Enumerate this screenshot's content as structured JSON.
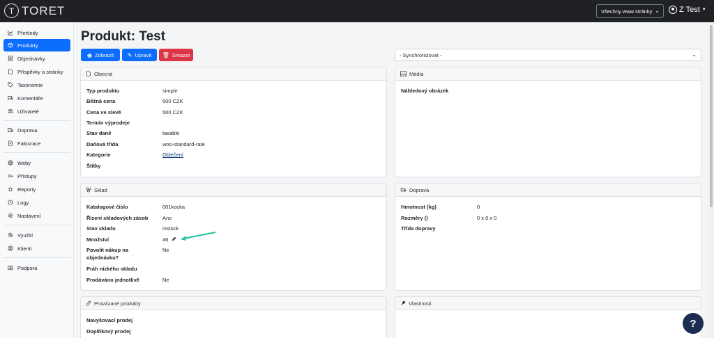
{
  "header": {
    "logo_letter": "T",
    "logo_text": "TORET",
    "site_select": "Všechny www stránky",
    "user_name": "Z Test"
  },
  "sidebar": {
    "items": [
      {
        "label": "Přehledy",
        "icon": "chart-icon"
      },
      {
        "label": "Produkty",
        "icon": "box-icon",
        "active": true
      },
      {
        "label": "Objednávky",
        "icon": "list-icon"
      },
      {
        "label": "Příspěvky a stránky",
        "icon": "file-icon"
      },
      {
        "label": "Taxonomie",
        "icon": "tags-icon"
      },
      {
        "label": "Komentáře",
        "icon": "comments-icon"
      },
      {
        "label": "Uživatelé",
        "icon": "users-icon"
      },
      {
        "label": "Doprava",
        "icon": "truck-icon"
      },
      {
        "label": "Fakturace",
        "icon": "invoice-icon"
      },
      {
        "label": "Weby",
        "icon": "globe-icon"
      },
      {
        "label": "Přístupy",
        "icon": "key-icon"
      },
      {
        "label": "Reporty",
        "icon": "bug-icon"
      },
      {
        "label": "Logy",
        "icon": "log-icon"
      },
      {
        "label": "Nastavení",
        "icon": "gear-icon"
      },
      {
        "label": "Využití",
        "icon": "gear-cog-icon"
      },
      {
        "label": "Klienti",
        "icon": "person-circle-icon"
      },
      {
        "label": "Podpora",
        "icon": "support-icon"
      }
    ]
  },
  "main": {
    "title": "Produkt: Test",
    "buttons": {
      "view": "Zobrazit",
      "edit": "Upravit",
      "delete": "Smazat"
    },
    "sync_select": "- Synchronizovat -",
    "general": {
      "title": "Obecné",
      "rows": [
        {
          "label": "Typ produktu",
          "value": "simple"
        },
        {
          "label": "Běžná cena",
          "value": "500 CZK"
        },
        {
          "label": "Cena ve slevě",
          "value": "500 CZK"
        },
        {
          "label": "Termín výprodeje",
          "value": ""
        },
        {
          "label": "Stav daně",
          "value": "taxable"
        },
        {
          "label": "Daňová třída",
          "value": "woo-standard-rate"
        },
        {
          "label": "Kategorie",
          "value": "Oblečení"
        },
        {
          "label": "Štítky",
          "value": ""
        }
      ]
    },
    "media": {
      "title": "Média",
      "thumbnail_label": "Náhledový obrázek"
    },
    "stock": {
      "title": "Sklad",
      "rows": [
        {
          "label": "Katalogové číslo",
          "value": "001kocka"
        },
        {
          "label": "Řízení skladových zásob",
          "value": "Ano"
        },
        {
          "label": "Stav skladu",
          "value": "instock"
        },
        {
          "label": "Množství",
          "value": "46"
        },
        {
          "label": "Povolit nákup na objednávku?",
          "value": "Ne"
        },
        {
          "label": "Práh nízkého skladu",
          "value": ""
        },
        {
          "label": "Prodáváno jednotlivě",
          "value": "Ne"
        }
      ]
    },
    "shipping": {
      "title": "Doprava",
      "rows": [
        {
          "label": "Hmotnost (kg)",
          "value": "0"
        },
        {
          "label": "Rozměry ()",
          "value": "0 x 0 x 0"
        },
        {
          "label": "Třída dopravy",
          "value": ""
        }
      ]
    },
    "linked": {
      "title": "Provázané produkty",
      "rows": [
        {
          "label": "Navyšovací prodej"
        },
        {
          "label": "Doplňkový prodej"
        }
      ]
    },
    "properties": {
      "title": "Vlastnosti"
    }
  },
  "help": {
    "label": "?"
  },
  "colors": {
    "primary": "#0d6efd",
    "danger": "#dc3545",
    "topbar": "#202124",
    "arrow": "#20c0a0"
  }
}
